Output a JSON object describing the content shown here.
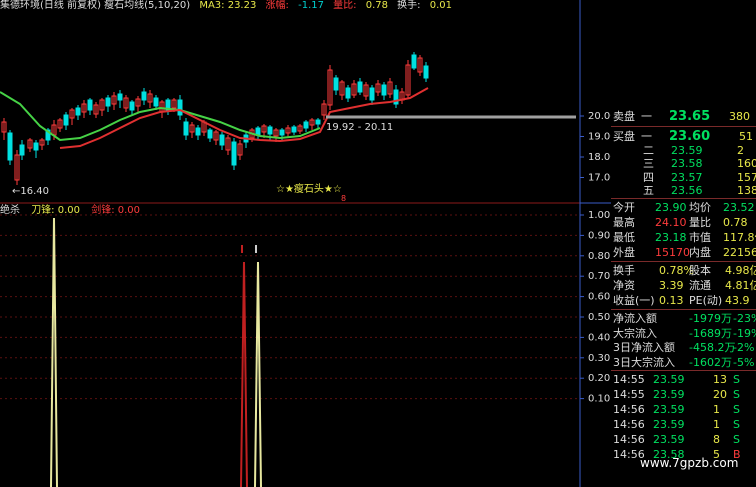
{
  "header": {
    "title": "集德环境(日线 前复权) 瘦石均线(5,10,20)",
    "ma3": "MA3: 23.23",
    "zf_label": "涨幅:",
    "zf_value": "-1.17",
    "lb_label": "量比:",
    "lb_value": "0.78",
    "hs_label": "换手:",
    "hs_value": "0.01"
  },
  "price_axis": [
    "20.00",
    "19.00",
    "18.00",
    "17.00"
  ],
  "annotations": {
    "low_price": "←16.40",
    "range_label": "19.92 - 20.11",
    "pattern_label": "☆★瘦石头★☆",
    "marker": "8"
  },
  "indicator": {
    "name": "绝杀",
    "l1": "刀锋: 0.00",
    "l2": "剑锋: 0.00"
  },
  "indicator_axis": [
    "1.00",
    "0.90",
    "0.80",
    "0.70",
    "0.60",
    "0.50",
    "0.40",
    "0.30",
    "0.20",
    "0.10"
  ],
  "order_book": {
    "sell_label": "卖盘",
    "sell": [
      {
        "n": "一",
        "p": "23.65",
        "v": "380"
      }
    ],
    "buy_label": "买盘",
    "buy": [
      {
        "n": "一",
        "p": "23.60",
        "v": "51"
      },
      {
        "n": "二",
        "p": "23.59",
        "v": "2"
      },
      {
        "n": "三",
        "p": "23.58",
        "v": "160"
      },
      {
        "n": "四",
        "p": "23.57",
        "v": "157"
      },
      {
        "n": "五",
        "p": "23.56",
        "v": "138"
      }
    ]
  },
  "quote": [
    {
      "k1": "今开",
      "v1": "23.90",
      "k2": "均价",
      "v2": "23.52"
    },
    {
      "k1": "最高",
      "v1": "24.10",
      "k2": "量比",
      "v2": "0.78"
    },
    {
      "k1": "最低",
      "v1": "23.18",
      "k2": "市值",
      "v2": "117.8亿"
    },
    {
      "k1": "外盘",
      "v1": "15170",
      "k2": "内盘",
      "v2": "22156"
    }
  ],
  "quote2": [
    {
      "k1": "换手",
      "v1": "0.78%",
      "k2": "股本",
      "v2": "4.98亿"
    },
    {
      "k1": "净资",
      "v1": "3.39",
      "k2": "流通",
      "v2": "4.81亿"
    },
    {
      "k1": "收益(一)",
      "v1": "0.13",
      "k2": "PE(动)",
      "v2": "43.9"
    }
  ],
  "flows": [
    {
      "k": "净流入额",
      "v": "-1979万",
      "p": "-23%"
    },
    {
      "k": "大宗流入",
      "v": "-1689万",
      "p": "-19%"
    },
    {
      "k": "3日净流入额",
      "v": "-458.2万",
      "p": "-2%"
    },
    {
      "k": "3日大宗流入",
      "v": "-1602万",
      "p": "-5%"
    }
  ],
  "ticks": [
    {
      "t": "14:55",
      "p": "23.59",
      "v": "13",
      "s": "S"
    },
    {
      "t": "14:55",
      "p": "23.59",
      "v": "20",
      "s": "S"
    },
    {
      "t": "14:56",
      "p": "23.59",
      "v": "1",
      "s": "S"
    },
    {
      "t": "14:56",
      "p": "23.59",
      "v": "1",
      "s": "S"
    },
    {
      "t": "14:56",
      "p": "23.59",
      "v": "8",
      "s": "S"
    },
    {
      "t": "14:56",
      "p": "23.58",
      "v": "5",
      "s": "B"
    }
  ],
  "watermark": "www.7gpzb.com",
  "colors": {
    "up": "#ff3c3c",
    "down": "#00e0e0",
    "ma_green": "#46d246",
    "ma_red": "#e03030",
    "grid": "#8b1a1a",
    "text_yellow": "#e8e84a"
  }
}
